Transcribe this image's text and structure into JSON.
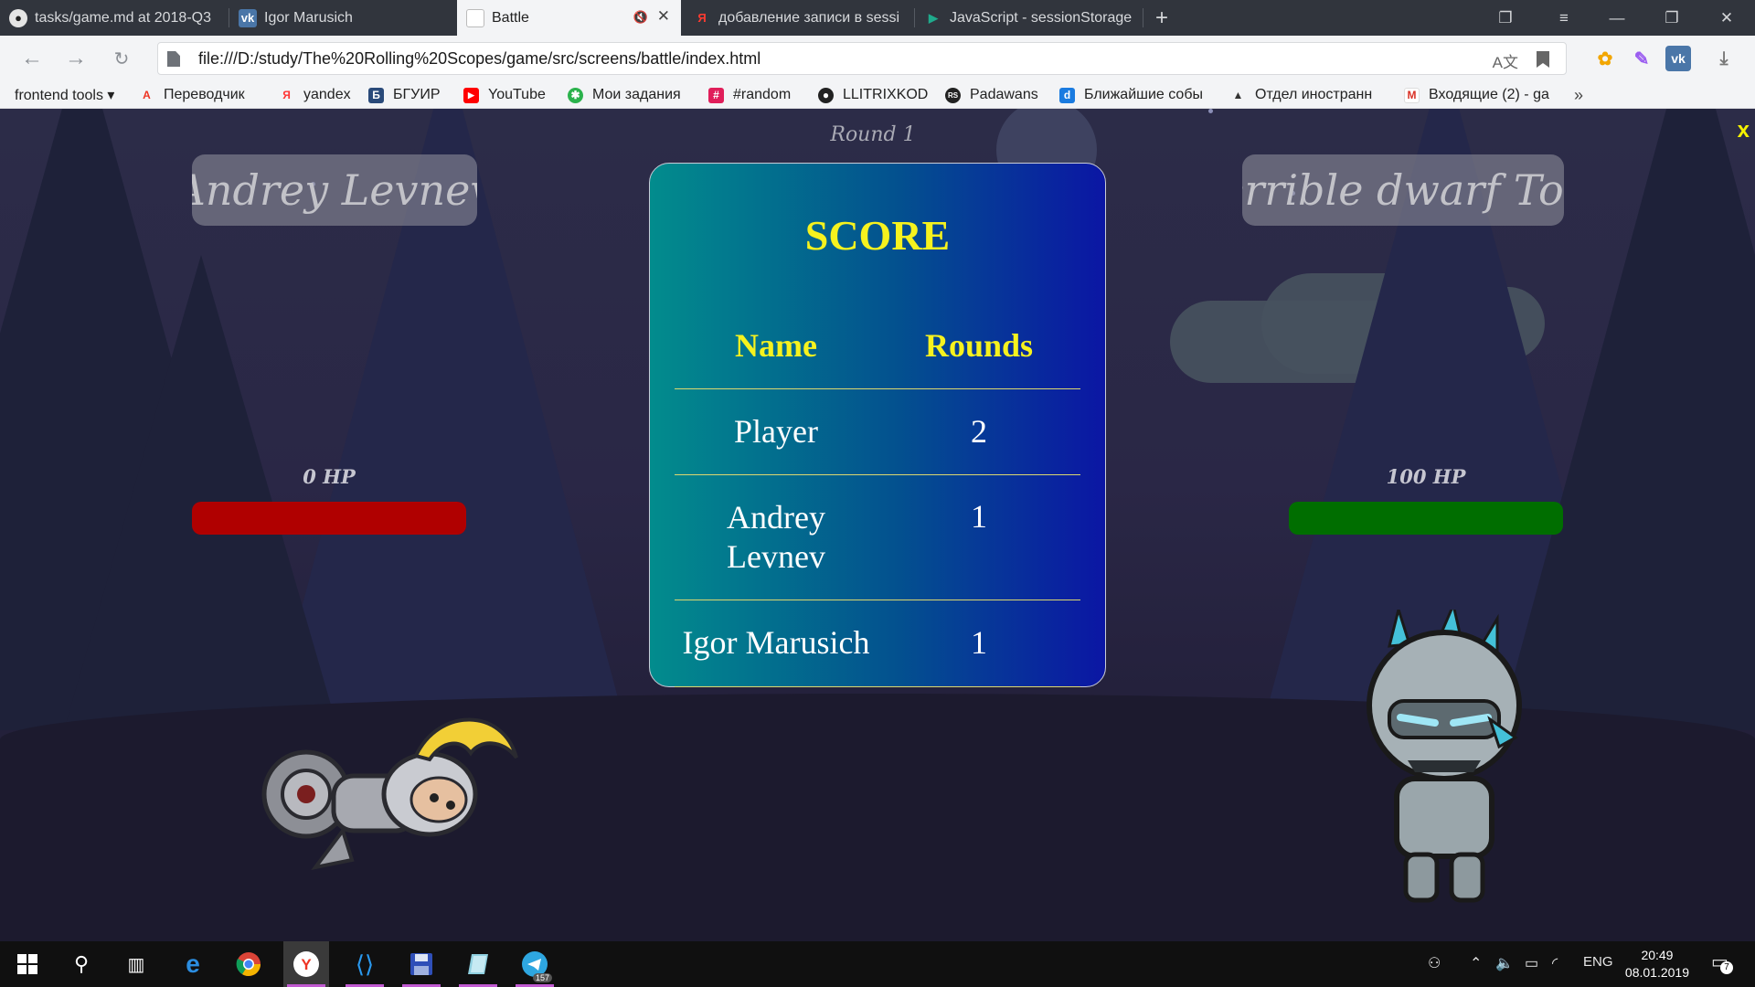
{
  "browser": {
    "tabs": [
      {
        "title": "tasks/game.md at 2018-Q3",
        "icon": "github-icon"
      },
      {
        "title": "Igor Marusich",
        "icon": "vk-icon"
      },
      {
        "title": "Battle",
        "icon": "page-icon",
        "active": true
      },
      {
        "title": "добавление записи в sessi",
        "icon": "yandex-icon"
      },
      {
        "title": "JavaScript - sessionStorage",
        "icon": "play-icon"
      }
    ],
    "address": "file:///D:/study/The%20Rolling%20Scopes/game/src/screens/battle/index.html",
    "bookmarks": [
      {
        "label": "frontend tools ▾",
        "icon": ""
      },
      {
        "label": "Переводчик",
        "icon": "translate-icon"
      },
      {
        "label": "yandex",
        "icon": "yandex-icon"
      },
      {
        "label": "БГУИР",
        "icon": "bsuir-icon"
      },
      {
        "label": "YouTube",
        "icon": "youtube-icon"
      },
      {
        "label": "Мои задания",
        "icon": "tasks-icon"
      },
      {
        "label": "#random",
        "icon": "slack-icon"
      },
      {
        "label": "LLITRIXKOD",
        "icon": "github-icon"
      },
      {
        "label": "Padawans",
        "icon": "rs-icon"
      },
      {
        "label": "Ближайшие собы",
        "icon": "d-icon"
      },
      {
        "label": "Отдел иностранн",
        "icon": "hat-icon"
      },
      {
        "label": "Входящие (2) - ga",
        "icon": "gmail-icon"
      }
    ]
  },
  "game": {
    "round": "Round 1",
    "player_left": {
      "name": "Andrey Levnev",
      "hp_text": "0 HP",
      "hp_value": 0
    },
    "player_right": {
      "name": "terrible dwarf Tom",
      "hp_text": "100 HP",
      "hp_value": 100
    },
    "close": "x",
    "colors": {
      "hp_low": "#b00000",
      "hp_full": "#006e00",
      "title": "#f6f21e"
    }
  },
  "score": {
    "title": "SCORE",
    "headers": {
      "name": "Name",
      "rounds": "Rounds"
    },
    "rows": [
      {
        "name": "Player",
        "rounds": "2"
      },
      {
        "name": "Andrey Levnev",
        "rounds": "1"
      },
      {
        "name": "Igor Marusich",
        "rounds": "1"
      }
    ]
  },
  "taskbar": {
    "language": "ENG",
    "time": "20:49",
    "date": "08.01.2019",
    "telegram_badge": "157",
    "notification_count": "7"
  }
}
